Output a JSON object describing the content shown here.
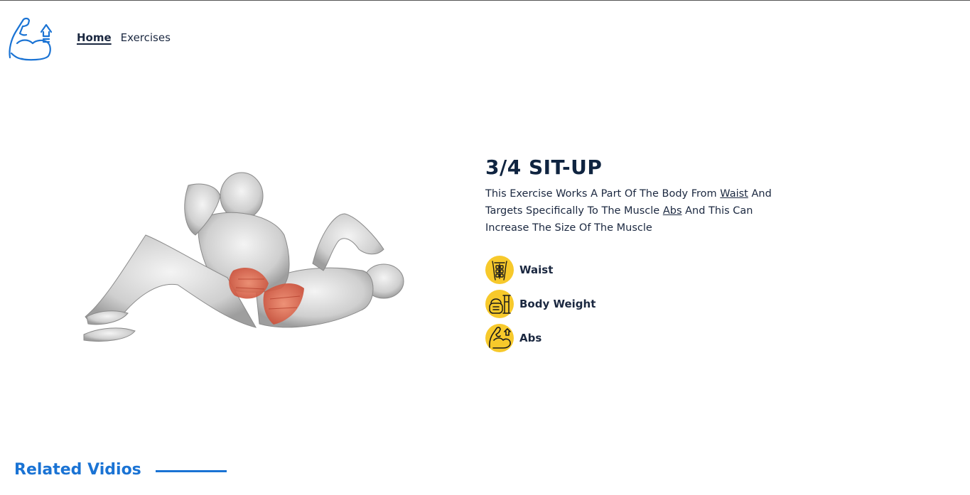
{
  "header": {
    "logo_icon": "flexed-arm-upgrade-icon",
    "nav": [
      {
        "label": "Home",
        "active": true
      },
      {
        "label": "Exercises",
        "active": false
      }
    ]
  },
  "exercise": {
    "image_icon": "sit-up-anatomy-illustration",
    "title": "3/4 SIT-UP",
    "desc_part1": "This Exercise Works A Part Of The Body From ",
    "body_part_link": "Waist",
    "desc_part2": " And Targets Specifically To The Muscle ",
    "target_link": "Abs",
    "desc_part3": " And This Can Increase The Size Of The Muscle",
    "tags": [
      {
        "label": "Waist",
        "icon": "torso-icon"
      },
      {
        "label": "Body Weight",
        "icon": "kettlebell-icon"
      },
      {
        "label": "Abs",
        "icon": "flexed-arm-icon"
      }
    ]
  },
  "related": {
    "title": "Related Vidios"
  },
  "colors": {
    "accent": "#1a73d4",
    "tag_bg": "#f7c92b",
    "text": "#1b2840",
    "muscle_highlight": "#e0624a"
  }
}
